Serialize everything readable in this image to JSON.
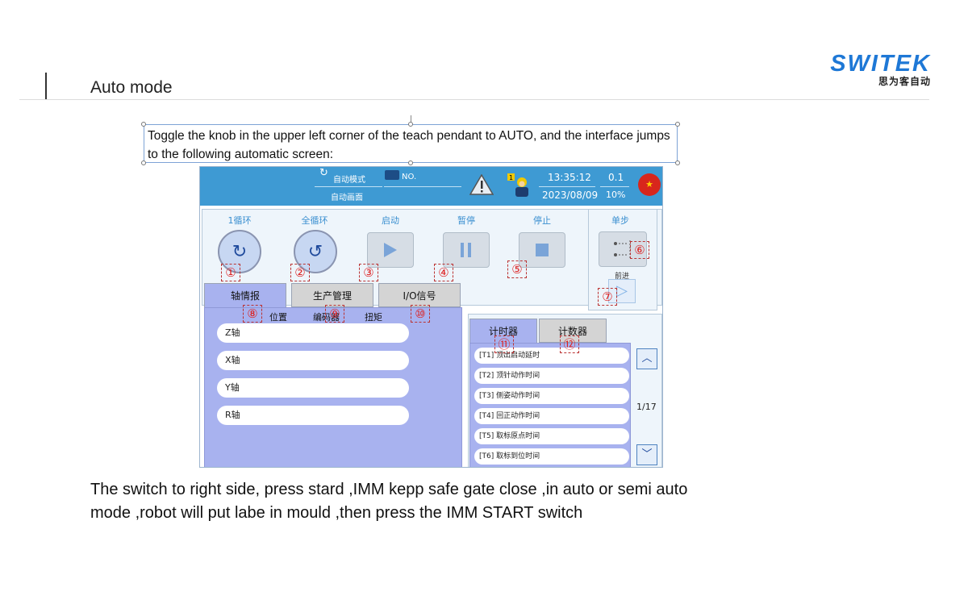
{
  "slide": {
    "title": "Auto mode",
    "brand_name": "SWITEK",
    "brand_sub": "思为客自动",
    "intro_text": "Toggle the knob in the upper left corner of the teach pendant to AUTO, and the interface jumps to the following automatic screen:",
    "bottom_text_line1": "The switch  to right side, press stard ,IMM kepp safe gate close ,in auto or semi auto",
    "bottom_text_line2": "mode ,robot will put labe in mould ,then  press the IMM START switch"
  },
  "pendant": {
    "topbar": {
      "mode": "自动模式",
      "screen": "自动画面",
      "program_no": "NO.",
      "time": "13:35:12",
      "date": "2023/08/09",
      "speed": "0.1",
      "speed_pct": "10%",
      "user_level": "1"
    },
    "controls": {
      "cycle_one_label": "1循环",
      "cycle_all_label": "全循环",
      "start_label": "启动",
      "pause_label": "暂停",
      "stop_label": "停止",
      "step_label": "单步",
      "forward_label": "前进"
    },
    "left_tabs": [
      "轴情报",
      "生产管理",
      "I/O信号"
    ],
    "sub_tabs": [
      "位置",
      "编码器",
      "扭矩"
    ],
    "axes": [
      "Z轴",
      "X轴",
      "Y轴",
      "R轴"
    ],
    "right_tabs": [
      "计时器",
      "计数器"
    ],
    "timers": [
      "[T1]   顶出启动延时",
      "[T2]   顶针动作时间",
      "[T3]   侧姿动作时间",
      "[T4]   回正动作时间",
      "[T5]   取标原点时间",
      "[T6]   取标到位时间"
    ],
    "page_indicator": "1/17"
  },
  "callouts": [
    "①",
    "②",
    "③",
    "④",
    "⑤",
    "⑥",
    "⑦",
    "⑧",
    "⑨",
    "⑩",
    "⑪",
    "⑫"
  ],
  "colors": {
    "topbar": "#3e9ad3",
    "panel": "#a8b2ef",
    "brand": "#1e78d6",
    "callout": "#d22222"
  }
}
